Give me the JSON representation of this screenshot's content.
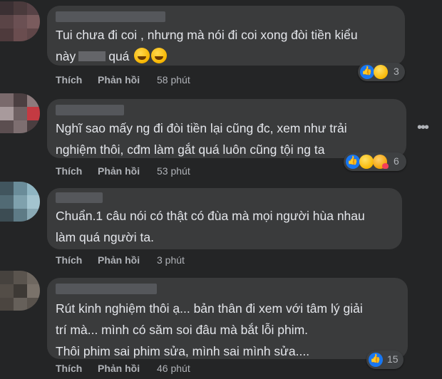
{
  "comments": [
    {
      "text_lines": [
        "Tui chưa đi coi , nhưng mà nói đi coi xong đòi tiền kiểu",
        "này",
        "quá"
      ],
      "like_label": "Thích",
      "reply_label": "Phản hồi",
      "time": "58 phút",
      "reaction_count": "3",
      "reactions": [
        "like-icon",
        "haha-icon"
      ]
    },
    {
      "text_lines": [
        "Nghĩ sao mấy ng đi đòi tiền lại cũng đc, xem như trải",
        "nghiệm thôi, cđm làm gắt quá luôn cũng tội ng ta"
      ],
      "like_label": "Thích",
      "reply_label": "Phản hồi",
      "time": "53 phút",
      "reaction_count": "6",
      "reactions": [
        "like-icon",
        "haha-icon",
        "care-icon"
      ]
    },
    {
      "text_lines": [
        "Chuẩn.1 câu nói có thật có đùa mà mọi người hùa nhau",
        "làm quá người ta."
      ],
      "like_label": "Thích",
      "reply_label": "Phản hồi",
      "time": "3 phút"
    },
    {
      "text_lines": [
        "Rút kinh nghiệm thôi ạ... bản thân đi xem với tâm lý giải",
        "trí mà... mình có săm soi đâu mà bắt lỗi phim.",
        "Thôi phim sai phim sửa, mình sai mình sửa...."
      ],
      "like_label": "Thích",
      "reply_label": "Phản hồi",
      "time": "46 phút",
      "reaction_count": "15",
      "reactions": [
        "like-icon"
      ]
    }
  ],
  "more_icon": "more-horizontal-icon",
  "colors": {
    "background": "#242526",
    "bubble": "#3a3b3c",
    "text": "#e4e6eb",
    "secondary": "#b0b3b8",
    "like": "#1877f2"
  }
}
